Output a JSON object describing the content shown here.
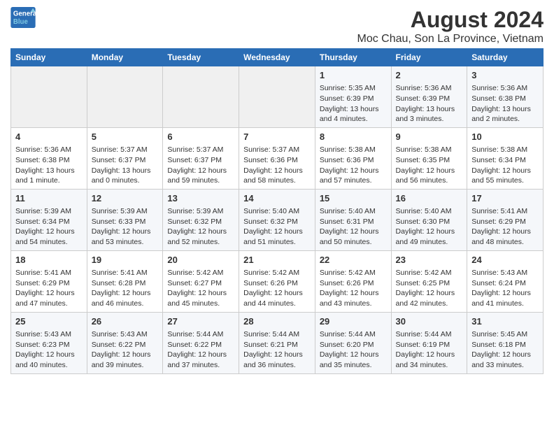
{
  "header": {
    "logo_line1": "General",
    "logo_line2": "Blue",
    "title": "August 2024",
    "subtitle": "Moc Chau, Son La Province, Vietnam"
  },
  "calendar": {
    "days_of_week": [
      "Sunday",
      "Monday",
      "Tuesday",
      "Wednesday",
      "Thursday",
      "Friday",
      "Saturday"
    ],
    "weeks": [
      [
        {
          "day": "",
          "content": ""
        },
        {
          "day": "",
          "content": ""
        },
        {
          "day": "",
          "content": ""
        },
        {
          "day": "",
          "content": ""
        },
        {
          "day": "1",
          "content": "Sunrise: 5:35 AM\nSunset: 6:39 PM\nDaylight: 13 hours\nand 4 minutes."
        },
        {
          "day": "2",
          "content": "Sunrise: 5:36 AM\nSunset: 6:39 PM\nDaylight: 13 hours\nand 3 minutes."
        },
        {
          "day": "3",
          "content": "Sunrise: 5:36 AM\nSunset: 6:38 PM\nDaylight: 13 hours\nand 2 minutes."
        }
      ],
      [
        {
          "day": "4",
          "content": "Sunrise: 5:36 AM\nSunset: 6:38 PM\nDaylight: 13 hours\nand 1 minute."
        },
        {
          "day": "5",
          "content": "Sunrise: 5:37 AM\nSunset: 6:37 PM\nDaylight: 13 hours\nand 0 minutes."
        },
        {
          "day": "6",
          "content": "Sunrise: 5:37 AM\nSunset: 6:37 PM\nDaylight: 12 hours\nand 59 minutes."
        },
        {
          "day": "7",
          "content": "Sunrise: 5:37 AM\nSunset: 6:36 PM\nDaylight: 12 hours\nand 58 minutes."
        },
        {
          "day": "8",
          "content": "Sunrise: 5:38 AM\nSunset: 6:36 PM\nDaylight: 12 hours\nand 57 minutes."
        },
        {
          "day": "9",
          "content": "Sunrise: 5:38 AM\nSunset: 6:35 PM\nDaylight: 12 hours\nand 56 minutes."
        },
        {
          "day": "10",
          "content": "Sunrise: 5:38 AM\nSunset: 6:34 PM\nDaylight: 12 hours\nand 55 minutes."
        }
      ],
      [
        {
          "day": "11",
          "content": "Sunrise: 5:39 AM\nSunset: 6:34 PM\nDaylight: 12 hours\nand 54 minutes."
        },
        {
          "day": "12",
          "content": "Sunrise: 5:39 AM\nSunset: 6:33 PM\nDaylight: 12 hours\nand 53 minutes."
        },
        {
          "day": "13",
          "content": "Sunrise: 5:39 AM\nSunset: 6:32 PM\nDaylight: 12 hours\nand 52 minutes."
        },
        {
          "day": "14",
          "content": "Sunrise: 5:40 AM\nSunset: 6:32 PM\nDaylight: 12 hours\nand 51 minutes."
        },
        {
          "day": "15",
          "content": "Sunrise: 5:40 AM\nSunset: 6:31 PM\nDaylight: 12 hours\nand 50 minutes."
        },
        {
          "day": "16",
          "content": "Sunrise: 5:40 AM\nSunset: 6:30 PM\nDaylight: 12 hours\nand 49 minutes."
        },
        {
          "day": "17",
          "content": "Sunrise: 5:41 AM\nSunset: 6:29 PM\nDaylight: 12 hours\nand 48 minutes."
        }
      ],
      [
        {
          "day": "18",
          "content": "Sunrise: 5:41 AM\nSunset: 6:29 PM\nDaylight: 12 hours\nand 47 minutes."
        },
        {
          "day": "19",
          "content": "Sunrise: 5:41 AM\nSunset: 6:28 PM\nDaylight: 12 hours\nand 46 minutes."
        },
        {
          "day": "20",
          "content": "Sunrise: 5:42 AM\nSunset: 6:27 PM\nDaylight: 12 hours\nand 45 minutes."
        },
        {
          "day": "21",
          "content": "Sunrise: 5:42 AM\nSunset: 6:26 PM\nDaylight: 12 hours\nand 44 minutes."
        },
        {
          "day": "22",
          "content": "Sunrise: 5:42 AM\nSunset: 6:26 PM\nDaylight: 12 hours\nand 43 minutes."
        },
        {
          "day": "23",
          "content": "Sunrise: 5:42 AM\nSunset: 6:25 PM\nDaylight: 12 hours\nand 42 minutes."
        },
        {
          "day": "24",
          "content": "Sunrise: 5:43 AM\nSunset: 6:24 PM\nDaylight: 12 hours\nand 41 minutes."
        }
      ],
      [
        {
          "day": "25",
          "content": "Sunrise: 5:43 AM\nSunset: 6:23 PM\nDaylight: 12 hours\nand 40 minutes."
        },
        {
          "day": "26",
          "content": "Sunrise: 5:43 AM\nSunset: 6:22 PM\nDaylight: 12 hours\nand 39 minutes."
        },
        {
          "day": "27",
          "content": "Sunrise: 5:44 AM\nSunset: 6:22 PM\nDaylight: 12 hours\nand 37 minutes."
        },
        {
          "day": "28",
          "content": "Sunrise: 5:44 AM\nSunset: 6:21 PM\nDaylight: 12 hours\nand 36 minutes."
        },
        {
          "day": "29",
          "content": "Sunrise: 5:44 AM\nSunset: 6:20 PM\nDaylight: 12 hours\nand 35 minutes."
        },
        {
          "day": "30",
          "content": "Sunrise: 5:44 AM\nSunset: 6:19 PM\nDaylight: 12 hours\nand 34 minutes."
        },
        {
          "day": "31",
          "content": "Sunrise: 5:45 AM\nSunset: 6:18 PM\nDaylight: 12 hours\nand 33 minutes."
        }
      ]
    ]
  }
}
